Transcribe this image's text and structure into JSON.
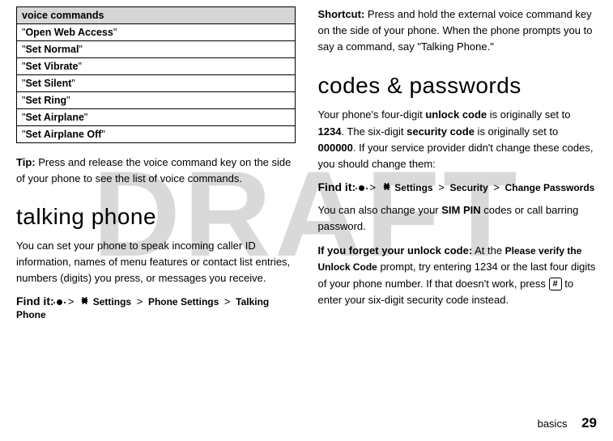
{
  "watermark": "DRAFT",
  "left": {
    "table_header": "voice commands",
    "rows": [
      {
        "cmd": "Open Web Access"
      },
      {
        "cmd": "Set Normal"
      },
      {
        "cmd": "Set Vibrate"
      },
      {
        "cmd": "Set Silent"
      },
      {
        "cmd": "Set Ring"
      },
      {
        "cmd": "Set Airplane"
      },
      {
        "cmd": "Set Airplane Off"
      }
    ],
    "tip_label": "Tip:",
    "tip_text": " Press and release the voice command key on the side of your phone to see the list of voice commands.",
    "heading": "talking phone",
    "body": "You can set your phone to speak incoming caller ID information, names of menu features or contact list entries, numbers (digits) you press, or messages you receive.",
    "findit_label": "Find it:",
    "findit_path": {
      "c1": "Settings",
      "c2": "Phone Settings",
      "c3": "Talking Phone"
    }
  },
  "right": {
    "shortcut_label": "Shortcut:",
    "shortcut_text": " Press and hold the external voice command key on the side of your phone. When the phone prompts you to say a command, say \"Talking Phone.\"",
    "heading": "codes & passwords",
    "body1_a": "Your phone's four-digit ",
    "body1_b": "unlock code",
    "body1_c": " is originally set to ",
    "body1_d": "1234",
    "body1_e": ". The six-digit ",
    "body1_f": "security code",
    "body1_g": " is originally set to ",
    "body1_h": "000000",
    "body1_i": ". If your service provider didn't change these codes, you should change them:",
    "findit_label": "Find it:",
    "findit_path": {
      "c1": "Settings",
      "c2": "Security",
      "c3": "Change Passwords"
    },
    "body2_a": "You can also change your ",
    "body2_b": "SIM PIN",
    "body2_c": " codes or call barring password.",
    "body3_a": "If you forget your unlock code:",
    "body3_b": " At the ",
    "body3_c": "Please verify the Unlock Code",
    "body3_d": " prompt, try entering 1234 or the last four digits of your phone number. If that doesn't work, press ",
    "body3_key": "#",
    "body3_e": " to enter your six-digit security code instead."
  },
  "footer": {
    "section": "basics",
    "page": "29"
  }
}
